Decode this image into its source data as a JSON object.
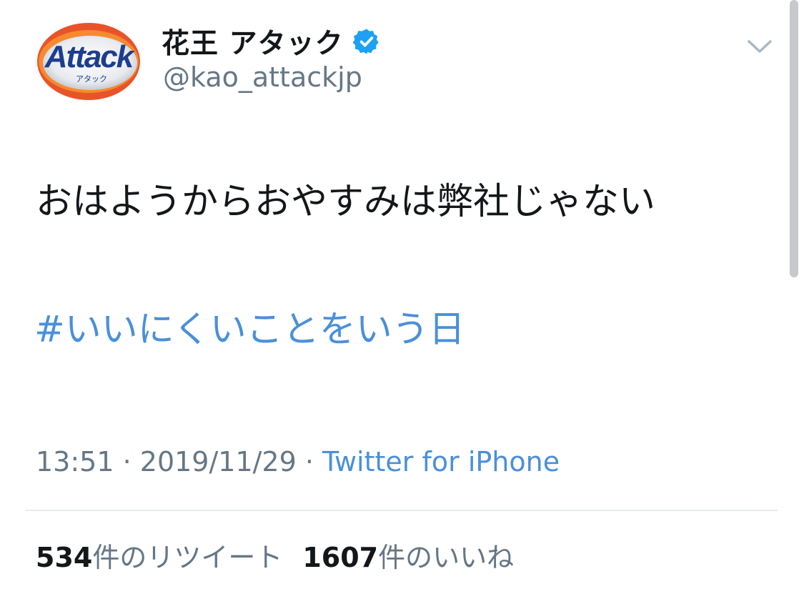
{
  "tweet": {
    "avatar": {
      "logo_text": "Attack",
      "logo_subtext": "アタック",
      "icon": "attack-logo-avatar"
    },
    "author": {
      "display_name": "花王 アタック",
      "handle": "@kao_attackjp",
      "verified": true
    },
    "menu_icon": "chevron-down-icon",
    "text": "おはようからおやすみは弊社じゃない",
    "hashtag": "#いいにくいことをいう日",
    "meta": {
      "time": "13:51",
      "separator": " · ",
      "date": "2019/11/29",
      "source": "Twitter for iPhone"
    },
    "stats": {
      "retweets_count": "534",
      "retweets_label": "件のリツイート",
      "likes_count": "1607",
      "likes_label": "件のいいね"
    }
  },
  "colors": {
    "link": "#4a90d9",
    "secondary_text": "#657786",
    "primary_text": "#14171a",
    "verified_badge": "#1da1f2"
  }
}
